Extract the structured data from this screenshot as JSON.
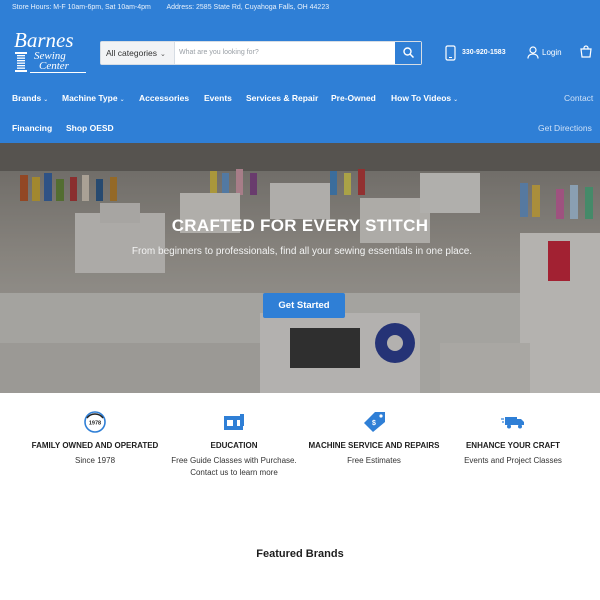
{
  "topbar": {
    "hours": "Store Hours: M-F 10am-6pm, Sat 10am-4pm",
    "address": "Address: 2585 State Rd, Cuyahoga Falls, OH 44223"
  },
  "logo": {
    "line1": "Barnes",
    "line2a": "Sewing",
    "line2b": "Center"
  },
  "search": {
    "category": "All categories",
    "placeholder": "What are you looking for?"
  },
  "header": {
    "phone": "330-920-1583",
    "login": "Login"
  },
  "nav": {
    "brands": "Brands",
    "machine_type": "Machine Type",
    "accessories": "Accessories",
    "events": "Events",
    "services": "Services & Repair",
    "pre_owned": "Pre-Owned",
    "how_to": "How To Videos",
    "contact": "Contact",
    "financing": "Financing",
    "shop_oesd": "Shop OESD",
    "directions": "Get Directions"
  },
  "hero": {
    "title": "CRAFTED FOR EVERY STITCH",
    "subtitle": "From beginners to professionals, find all your sewing essentials in one place.",
    "cta": "Get Started"
  },
  "features": [
    {
      "icon": "since-1978-badge-icon",
      "badge": "1978",
      "title": "FAMILY OWNED AND OPERATED",
      "desc": "Since 1978"
    },
    {
      "icon": "sewing-machine-icon",
      "title": "EDUCATION",
      "desc": "Free Guide Classes with Purchase. Contact us to learn more"
    },
    {
      "icon": "price-tag-icon",
      "title": "MACHINE SERVICE AND REPAIRS",
      "desc": "Free Estimates"
    },
    {
      "icon": "delivery-truck-icon",
      "title": "ENHANCE YOUR CRAFT",
      "desc": "Events and Project Classes"
    }
  ],
  "featured": {
    "title": "Featured Brands"
  },
  "colors": {
    "brand_blue": "#2f7fd6",
    "header_text": "#ffffff"
  }
}
